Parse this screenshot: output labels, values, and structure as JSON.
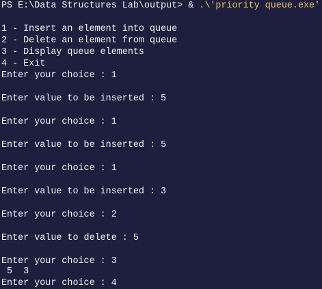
{
  "terminal": {
    "prompt": {
      "prefix": "PS E:\\Data Structures Lab\\output> ",
      "operator": "& ",
      "command": ".\\'priority queue.exe'"
    },
    "lines": [
      "1 - Insert an element into queue",
      "2 - Delete an element from queue",
      "3 - Display queue elements",
      "4 - Exit",
      "Enter your choice : 1",
      "Enter value to be inserted : 5",
      "Enter your choice : 1",
      "Enter value to be inserted : 5",
      "Enter your choice : 1",
      "Enter value to be inserted : 3",
      "Enter your choice : 2",
      "Enter value to delete : 5",
      "Enter your choice : 3",
      " 5  3",
      "Enter your choice : 4"
    ]
  },
  "colors": {
    "background": "#1e1f3f",
    "text": "#f2f2f2",
    "string": "#e6c35c"
  }
}
